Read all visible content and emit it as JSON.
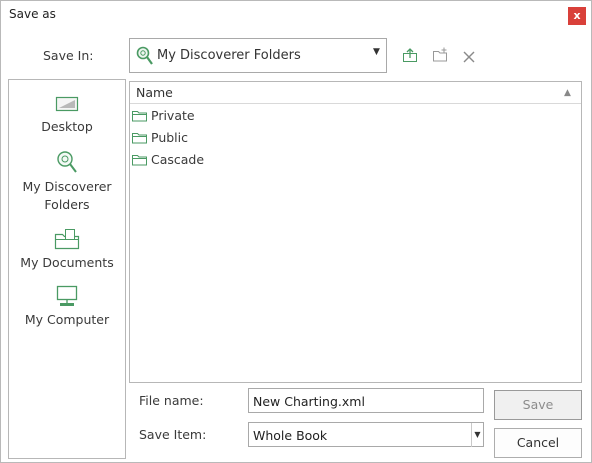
{
  "window": {
    "title": "Save as",
    "close_label": "x"
  },
  "save_in": {
    "label": "Save In:",
    "value": "My Discoverer Folders",
    "icon": "discoverer-search-icon"
  },
  "toolbar": {
    "icons": [
      "up-one-level-icon",
      "new-folder-icon",
      "delete-icon"
    ]
  },
  "places": [
    {
      "label": "Desktop",
      "icon": "desktop-icon"
    },
    {
      "label": "My Discoverer\nFolders",
      "icon": "discoverer-search-icon"
    },
    {
      "label": "My Documents",
      "icon": "documents-folder-icon"
    },
    {
      "label": "My Computer",
      "icon": "computer-icon"
    }
  ],
  "file_list": {
    "column": "Name",
    "sort": "ascending",
    "items": [
      {
        "name": "Private",
        "icon": "folder-icon"
      },
      {
        "name": "Public",
        "icon": "folder-icon"
      },
      {
        "name": "Cascade",
        "icon": "folder-icon"
      }
    ]
  },
  "form": {
    "file_name_label": "File name:",
    "file_name_value": "New Charting.xml",
    "save_item_label": "Save Item:",
    "save_item_value": "Whole Book"
  },
  "buttons": {
    "save": "Save",
    "cancel": "Cancel"
  },
  "colors": {
    "accent_green": "#4a9a63",
    "close_red": "#d9403a"
  }
}
